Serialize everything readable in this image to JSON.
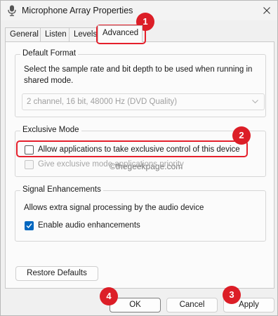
{
  "window": {
    "title": "Microphone Array Properties",
    "accent_color": "#0067c0",
    "annotation_color": "#dc1e27"
  },
  "tabs": [
    {
      "label": "General",
      "active": false
    },
    {
      "label": "Listen",
      "active": false
    },
    {
      "label": "Levels",
      "active": false
    },
    {
      "label": "Advanced",
      "active": true
    }
  ],
  "default_format": {
    "legend": "Default Format",
    "description": "Select the sample rate and bit depth to be used when running in shared mode.",
    "selected_value": "2 channel, 16 bit, 48000 Hz (DVD Quality)"
  },
  "watermark": "©thegeekpage.com",
  "exclusive_mode": {
    "legend": "Exclusive Mode",
    "allow_label": "Allow applications to take exclusive control of this device",
    "allow_checked": false,
    "priority_label": "Give exclusive mode applications priority",
    "priority_checked": false,
    "priority_enabled": false
  },
  "signal_enhancements": {
    "legend": "Signal Enhancements",
    "description": "Allows extra signal processing by the audio device",
    "enable_label": "Enable audio enhancements",
    "enable_checked": true
  },
  "buttons": {
    "restore_defaults": "Restore Defaults",
    "ok": "OK",
    "cancel": "Cancel",
    "apply": "Apply"
  },
  "annotations": [
    "1",
    "2",
    "3",
    "4"
  ]
}
